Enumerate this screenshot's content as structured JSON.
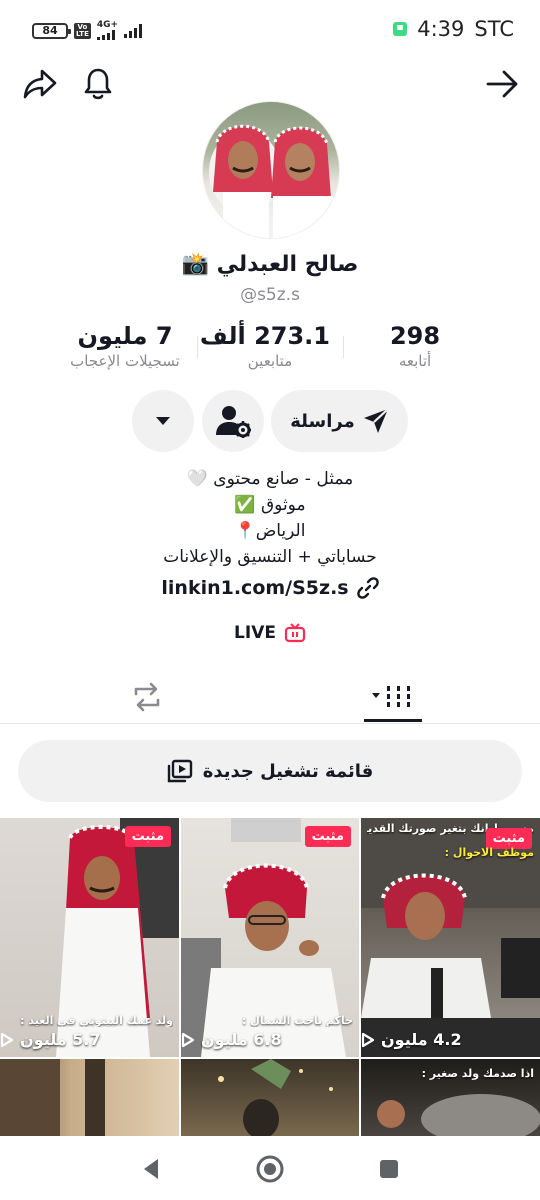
{
  "status_bar": {
    "battery": "84",
    "volte": "Vo LTE",
    "network": "4G+",
    "time": "4:39",
    "carrier": "STC"
  },
  "profile": {
    "display_name": "صالح العبدلي 📸",
    "username": "@s5z.s",
    "stats": {
      "likes_value": "7 مليون",
      "likes_label": "تسجيلات الإعجاب",
      "followers_value": "273.1 ألف",
      "followers_label": "متابعين",
      "following_value": "298",
      "following_label": "أتابعه"
    },
    "message_button": "مراسلة",
    "bio": [
      "ممثل - صانع محتوى 🤍",
      "موثوق  ✅",
      "الرياض📍",
      "حساباتي + التنسيق والإعلانات"
    ],
    "link": "linkin1.com/S5z.s",
    "live_label": "LIVE"
  },
  "playlist_button": "قائمة تشغيل جديدة",
  "videos": [
    {
      "pinned": "مثبت",
      "caption": "ولد عمك البيتوتي في العيد :",
      "views": "5.7 مليون"
    },
    {
      "pinned": "مثبت",
      "caption": "جاكم باحث الشمال :",
      "views": "6.8 مليون"
    },
    {
      "pinned": "مثبت",
      "top_text": "مسيمط انك بتغير صورتك القديمة",
      "sub_text": "موظف الاحوال :",
      "views": "4.2 مليون"
    },
    {
      "caption": ""
    },
    {
      "caption": ""
    },
    {
      "top_text": "اذا صدمك ولد صغير :"
    }
  ],
  "colors": {
    "accent": "#fe2c55",
    "text": "#161823",
    "muted": "#8a8b91",
    "button_bg": "#f1f1f2"
  }
}
